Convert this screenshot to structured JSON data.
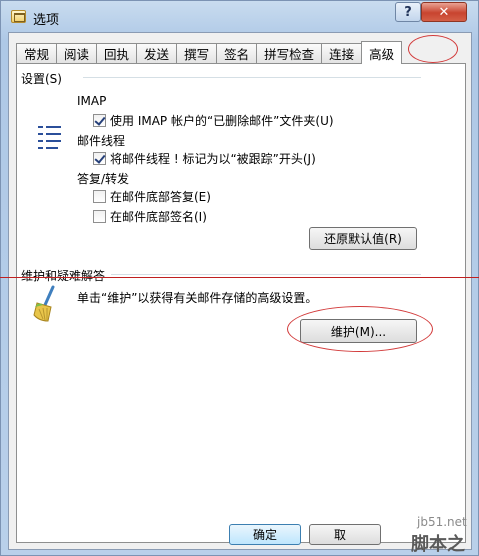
{
  "window": {
    "title": "选项",
    "help_label": "?",
    "close_label": "✕"
  },
  "tabs": [
    "常规",
    "阅读",
    "回执",
    "发送",
    "撰写",
    "签名",
    "拼写检查",
    "连接",
    "高级"
  ],
  "active_tab": "高级",
  "settings": {
    "group_label": "设置(S)",
    "imap_label": "IMAP",
    "imap_checkbox": {
      "label": "使用 IMAP 帐户的“已删除邮件”文件夹(U)",
      "checked": true
    },
    "thread_label": "邮件线程",
    "thread_checkbox": {
      "label": "将邮件线程 ! 标记为以“被跟踪”开头(J)",
      "checked": true
    },
    "reply_label": "答复/转发",
    "reply_top_checkbox": {
      "label": "在邮件底部答复(E)",
      "checked": false
    },
    "sign_bottom_checkbox": {
      "label": "在邮件底部签名(I)",
      "checked": false
    },
    "restore_button": "还原默认值(R)"
  },
  "maintenance": {
    "group_label": "维护和疑难解答",
    "description": "单击“维护”以获得有关邮件存储的高级设置。",
    "maintenance_button": "维护(M)..."
  },
  "footer": {
    "ok_button": "确定",
    "cancel_button": "取"
  },
  "watermark": {
    "site": "jb51.net",
    "brand": "脚本之家"
  },
  "colors": {
    "annotation_red": "#d23a3a",
    "focus_blue": "#3c7fb1"
  }
}
